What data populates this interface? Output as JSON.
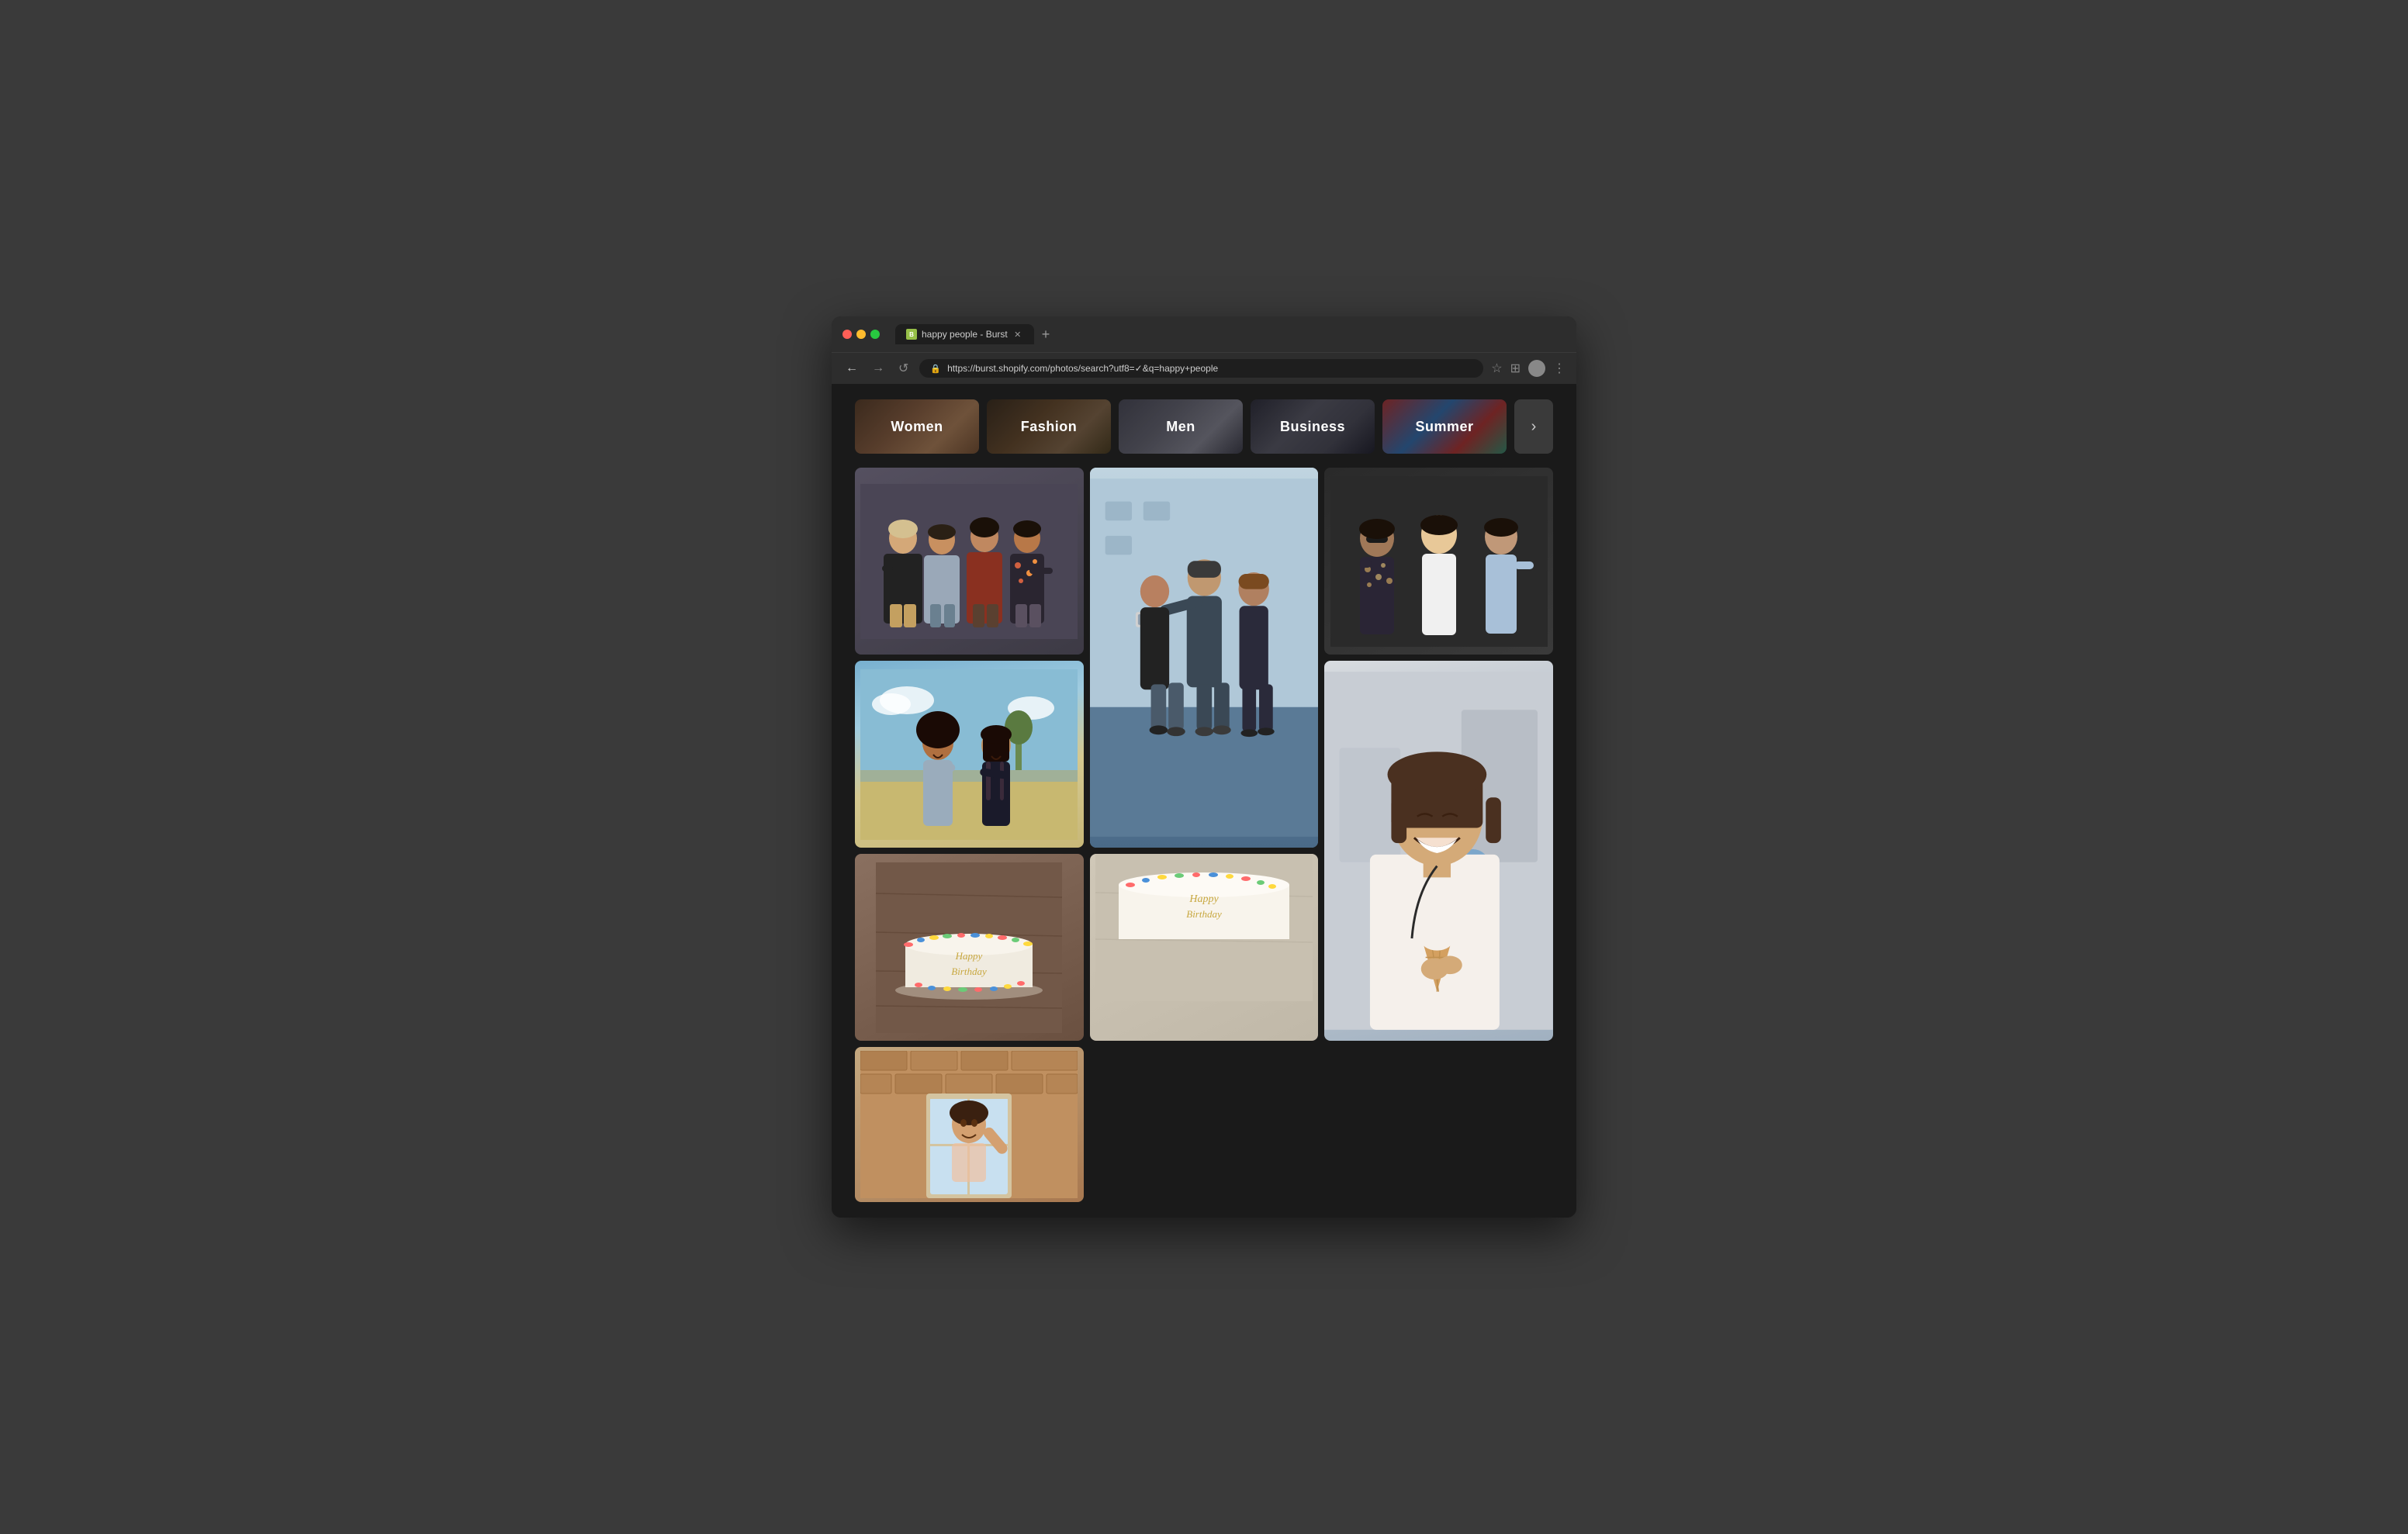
{
  "browser": {
    "tab_title": "happy people - Burst",
    "tab_favicon": "B",
    "url": "https://burst.shopify.com/photos/search?utf8=✓&q=happy+people",
    "nav": {
      "back": "←",
      "forward": "→",
      "refresh": "↺"
    }
  },
  "categories": [
    {
      "id": "women",
      "label": "Women",
      "class": "cat-women"
    },
    {
      "id": "fashion",
      "label": "Fashion",
      "class": "cat-fashion"
    },
    {
      "id": "men",
      "label": "Men",
      "class": "cat-men"
    },
    {
      "id": "business",
      "label": "Business",
      "class": "cat-business"
    },
    {
      "id": "summer",
      "label": "Summer",
      "class": "cat-summer"
    }
  ],
  "next_button_label": "›",
  "photos": [
    {
      "id": "photo-1",
      "alt": "Group of four people posing against gray wall",
      "span": "normal"
    },
    {
      "id": "photo-2",
      "alt": "Three friends taking a selfie outdoors",
      "span": "tall"
    },
    {
      "id": "photo-3",
      "alt": "Three people standing together smiling",
      "span": "normal"
    },
    {
      "id": "photo-4",
      "alt": "Two women laughing on a beach",
      "span": "normal"
    },
    {
      "id": "photo-5",
      "alt": "Woman smiling holding ice cream cone",
      "span": "tall"
    },
    {
      "id": "photo-6",
      "alt": "Birthday cake with Happy Birthday writing",
      "span": "normal"
    },
    {
      "id": "photo-7",
      "alt": "Birthday cake plate partial view",
      "span": "normal"
    },
    {
      "id": "photo-8",
      "alt": "Person waving from window",
      "span": "normal"
    }
  ],
  "page_title": "happy people Burst"
}
